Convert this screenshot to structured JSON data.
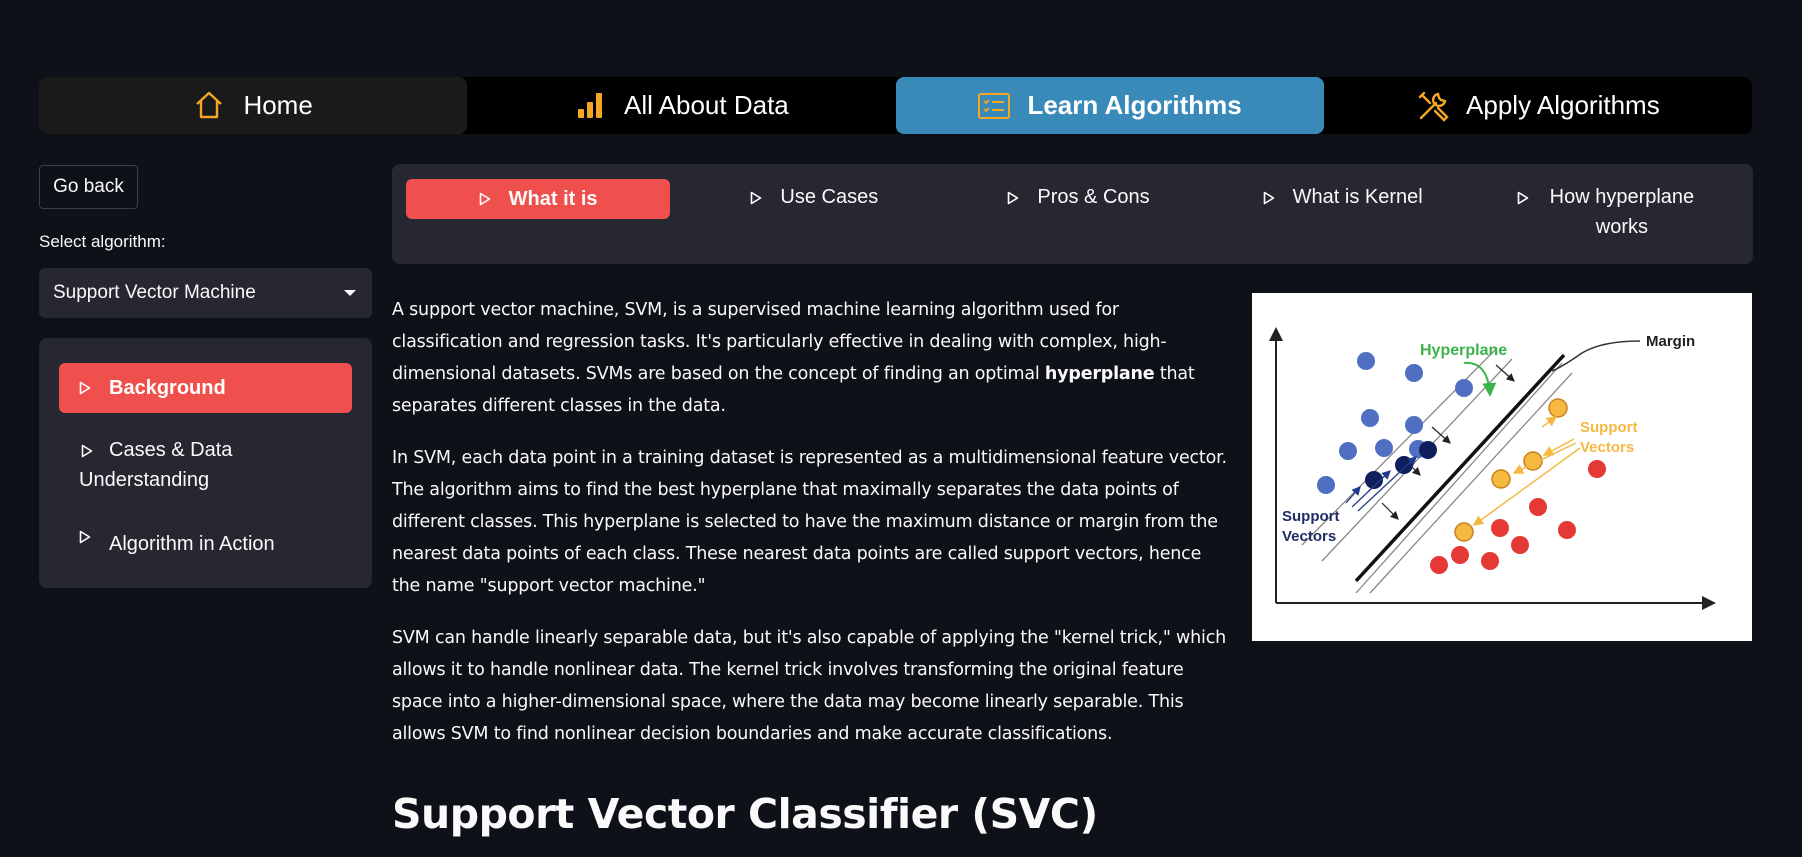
{
  "topnav": {
    "tabs": [
      {
        "label": "Home",
        "icon": "home-icon"
      },
      {
        "label": "All About Data",
        "icon": "bar-chart-icon"
      },
      {
        "label": "Learn Algorithms",
        "icon": "list-card-icon"
      },
      {
        "label": "Apply Algorithms",
        "icon": "tools-icon"
      }
    ],
    "active": "Learn Algorithms",
    "colors": {
      "active": "#3a8ab9",
      "icon": "#f5a623"
    }
  },
  "sidebar": {
    "go_back": "Go back",
    "select_label": "Select algorithm:",
    "selected_algorithm": "Support Vector Machine",
    "items": [
      {
        "label": "Background",
        "active": true
      },
      {
        "label": "Cases & Data Understanding"
      },
      {
        "label": "Algorithm in Action"
      }
    ]
  },
  "content_tabs": [
    {
      "label": "What it is",
      "active": true
    },
    {
      "label": "Use Cases"
    },
    {
      "label": "Pros & Cons"
    },
    {
      "label": "What is Kernel"
    },
    {
      "label": "How hyperplane works"
    }
  ],
  "paragraphs": {
    "p1_a": "A support vector machine, SVM, is a supervised machine learning algorithm used for classification and regression tasks. It's particularly effective in dealing with complex, high-dimensional datasets. SVMs are based on the concept of finding an optimal ",
    "p1_bold": "hyperplane",
    "p1_b": " that separates different classes in the data.",
    "p2": "In SVM, each data point in a training dataset is represented as a multidimensional feature vector. The algorithm aims to find the best hyperplane that maximally separates the data points of different classes. This hyperplane is selected to have the maximum distance or margin from the nearest data points of each class. These nearest data points are called support vectors, hence the name \"support vector machine.\"",
    "p3": "SVM can handle linearly separable data, but it's also capable of applying the \"kernel trick,\" which allows it to handle nonlinear data. The kernel trick involves transforming the original feature space into a higher-dimensional space, where the data may become linearly separable. This allows SVM to find nonlinear decision boundaries and make accurate classifications."
  },
  "heading": "Support Vector Classifier (SVC)",
  "diagram": {
    "labels": {
      "hyperplane": "Hyperplane",
      "margin": "Margin",
      "support_vectors_right_1": "Support",
      "support_vectors_right_2": "Vectors",
      "support_vectors_left_1": "Support",
      "support_vectors_left_2": "Vectors"
    },
    "colors": {
      "blue": "#4f6fc2",
      "navy": "#0f1f5c",
      "red": "#e53935",
      "gold": "#f5b942",
      "green": "#3cb34a"
    }
  },
  "accent_color": "#f0504d"
}
